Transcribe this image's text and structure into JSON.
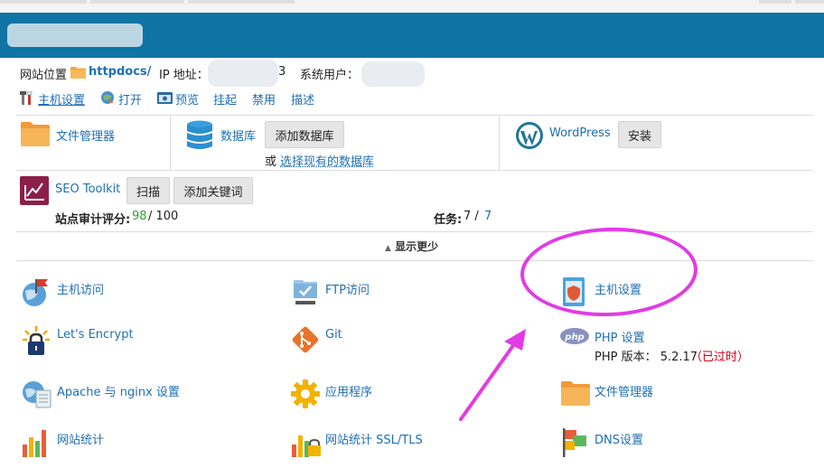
{
  "infobar": {
    "location_label": "网站位置",
    "location_value": "httpdocs/",
    "ip_label": "IP 地址：",
    "ip_value_tail": "3",
    "sysuser_label": "系统用户："
  },
  "actions": {
    "host_settings": "主机设置",
    "open": "打开",
    "preview": "预览",
    "suspend": "挂起",
    "disable": "禁用",
    "describe": "描述"
  },
  "tools": {
    "file_manager": "文件管理器",
    "databases": "数据库",
    "add_database": "添加数据库",
    "or": "或",
    "select_existing_db": "选择现有的数据库",
    "wordpress": "WordPress",
    "install": "安装",
    "seo_toolkit": "SEO Toolkit",
    "scan": "扫描",
    "add_keywords": "添加关键词",
    "audit_label": "站点审计评分:",
    "audit_score": "98",
    "audit_total": "/ 100",
    "tasks_label": "任务:",
    "tasks_done": "7 /",
    "tasks_total": "7"
  },
  "toggle": {
    "label": "显示更少"
  },
  "grid": {
    "hosting_access": "主机访问",
    "ftp_access": "FTP访问",
    "hosting_settings": "主机设置",
    "lets_encrypt": "Let's Encrypt",
    "git": "Git",
    "php_settings": "PHP 设置",
    "php_version_label": "PHP 版本： 5.2.17",
    "php_outdated": "（已过时）",
    "apache_nginx": "Apache 与 nginx 设置",
    "applications": "应用程序",
    "file_manager": "文件管理器",
    "web_stats": "网站统计",
    "web_stats_ssl": "网站统计 SSL/TLS",
    "dns": "DNS设置"
  },
  "colors": {
    "banner": "#0f73a3",
    "link": "#1f6fb4",
    "annotation": "#e23be6",
    "score_green": "#2e9e3a",
    "outdated_red": "#d0021b"
  }
}
